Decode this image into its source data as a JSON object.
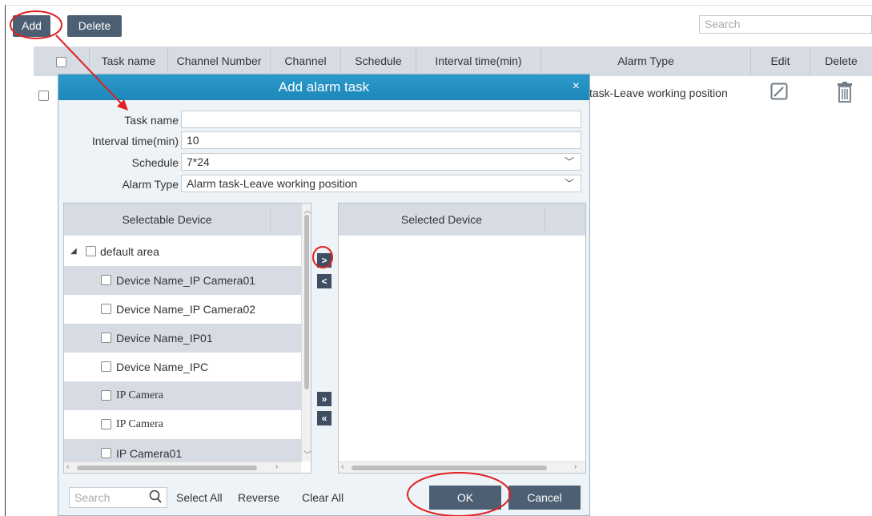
{
  "toolbar": {
    "add_label": "Add",
    "delete_label": "Delete",
    "search_placeholder": "Search"
  },
  "table": {
    "headers": [
      "Task name",
      "Channel Number",
      "Channel",
      "Schedule",
      "Interval time(min)",
      "Alarm Type",
      "Edit",
      "Delete"
    ],
    "row_alarm_type_visible": "task-Leave working position"
  },
  "dialog": {
    "title": "Add alarm task",
    "close": "×",
    "fields": {
      "task_name_label": "Task name",
      "task_name_value": "",
      "interval_label": "Interval time(min)",
      "interval_value": "10",
      "schedule_label": "Schedule",
      "schedule_value": "7*24",
      "alarm_type_label": "Alarm Type",
      "alarm_type_value": "Alarm task-Leave working position"
    },
    "selectable_header": "Selectable Device",
    "selected_header": "Selected Device",
    "tree_root": "default area",
    "devices": [
      "Device Name_IP Camera01",
      "Device Name_IP Camera02",
      "Device Name_IP01",
      "Device Name_IPC",
      "IP Camera",
      "IP Camera",
      "IP Camera01"
    ],
    "move_buttons": {
      "add_one": ">",
      "remove_one": "<",
      "add_all": "»",
      "remove_all": "«"
    },
    "bottom": {
      "search_placeholder": "Search",
      "select_all": "Select All",
      "reverse": "Reverse",
      "clear_all": "Clear All",
      "ok": "OK",
      "cancel": "Cancel"
    }
  },
  "colors": {
    "accent": "#2b9ac9",
    "button": "#4d5f72",
    "header": "#d7dce4",
    "annotation": "#e02020"
  }
}
